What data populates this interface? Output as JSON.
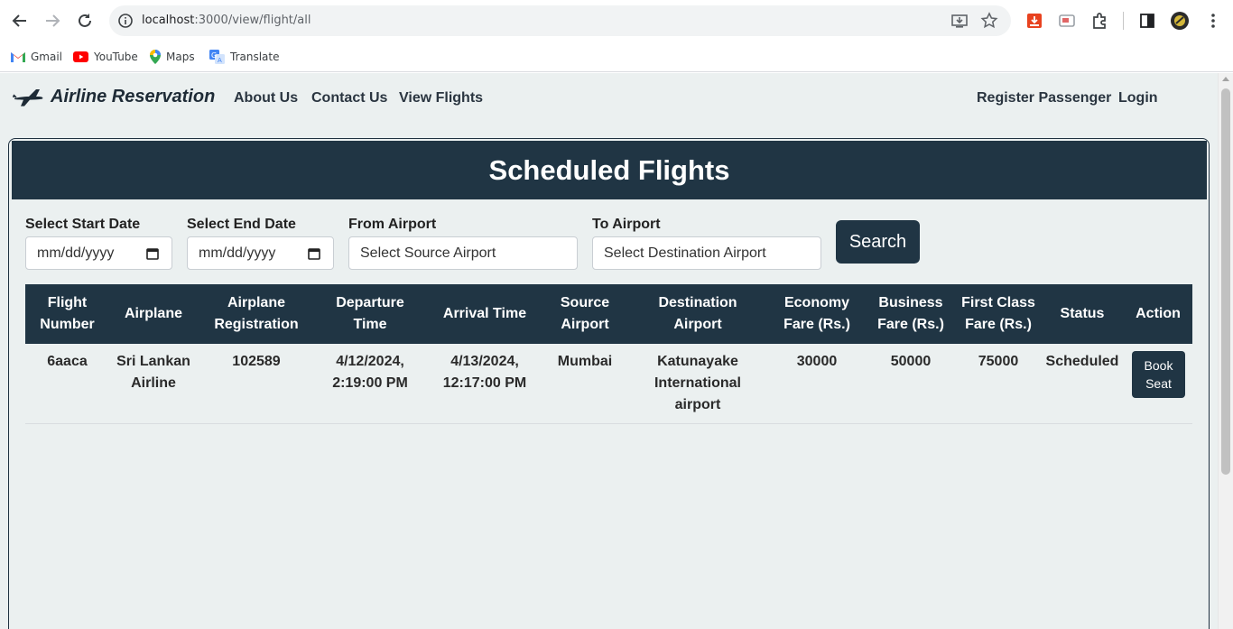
{
  "browser": {
    "url_host": "localhost",
    "url_rest": ":3000/view/flight/all"
  },
  "bookmarks": [
    {
      "label": "Gmail",
      "icon": "gmail-icon"
    },
    {
      "label": "YouTube",
      "icon": "youtube-icon"
    },
    {
      "label": "Maps",
      "icon": "maps-icon"
    },
    {
      "label": "Translate",
      "icon": "translate-icon"
    }
  ],
  "navbar": {
    "brand": "Airline Reservation",
    "links": [
      "About Us",
      "Contact Us",
      "View Flights"
    ],
    "right_links": [
      "Register Passenger",
      "Login"
    ]
  },
  "page": {
    "title": "Scheduled Flights"
  },
  "filters": {
    "start_date_label": "Select Start Date",
    "start_date_placeholder": "mm/dd/yyyy",
    "end_date_label": "Select End Date",
    "end_date_placeholder": "mm/dd/yyyy",
    "from_label": "From Airport",
    "from_placeholder": "Select Source Airport",
    "to_label": "To Airport",
    "to_placeholder": "Select Destination Airport",
    "search_label": "Search"
  },
  "table": {
    "headers": [
      [
        "Flight",
        "Number"
      ],
      [
        "Airplane"
      ],
      [
        "Airplane",
        "Registration"
      ],
      [
        "Departure",
        "Time"
      ],
      [
        "Arrival Time"
      ],
      [
        "Source",
        "Airport"
      ],
      [
        "Destination",
        "Airport"
      ],
      [
        "Economy",
        "Fare (Rs.)"
      ],
      [
        "Business",
        "Fare (Rs.)"
      ],
      [
        "First Class",
        "Fare (Rs.)"
      ],
      [
        "Status"
      ],
      [
        "Action"
      ]
    ],
    "rows": [
      {
        "flight_number": "6aaca",
        "airplane": [
          "Sri Lankan",
          "Airline"
        ],
        "registration": "102589",
        "departure": [
          "4/12/2024,",
          "2:19:00 PM"
        ],
        "arrival": [
          "4/13/2024,",
          "12:17:00 PM"
        ],
        "source": "Mumbai",
        "destination": [
          "Katunayake",
          "International",
          "airport"
        ],
        "economy_fare": "30000",
        "business_fare": "50000",
        "first_class_fare": "75000",
        "status": "Scheduled",
        "action": [
          "Book",
          "Seat"
        ]
      }
    ]
  },
  "colors": {
    "primary": "#203544",
    "background": "#ebf0f0"
  }
}
